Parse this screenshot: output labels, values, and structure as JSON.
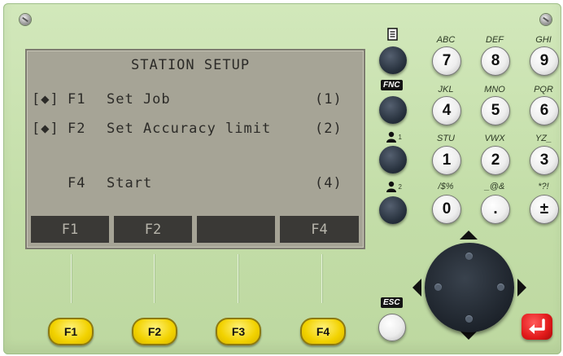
{
  "screen": {
    "title": "STATION SETUP",
    "rows": [
      {
        "marker": "[◆]",
        "key": "F1",
        "label": "Set Job",
        "code": "(1)"
      },
      {
        "marker": "[◆]",
        "key": "F2",
        "label": "Set Accuracy limit",
        "code": "(2)"
      },
      {
        "marker": "",
        "key": "F4",
        "label": "Start",
        "code": "(4)"
      }
    ],
    "softkeys": [
      "F1",
      "F2",
      "",
      "F4"
    ]
  },
  "function_keys": [
    "F1",
    "F2",
    "F3",
    "F4"
  ],
  "side_keys": {
    "fnc_tag": "FNC",
    "esc_tag": "ESC",
    "user1_sub": "1",
    "user2_sub": "2"
  },
  "keypad": [
    {
      "digit": "7",
      "letters": "ABC"
    },
    {
      "digit": "8",
      "letters": "DEF"
    },
    {
      "digit": "9",
      "letters": "GHI"
    },
    {
      "digit": "4",
      "letters": "JKL"
    },
    {
      "digit": "5",
      "letters": "MNO"
    },
    {
      "digit": "6",
      "letters": "PQR"
    },
    {
      "digit": "1",
      "letters": "STU"
    },
    {
      "digit": "2",
      "letters": "VWX"
    },
    {
      "digit": "3",
      "letters": "YZ_"
    },
    {
      "digit": "0",
      "letters": "/$%"
    },
    {
      "digit": ".",
      "letters": "_@&"
    },
    {
      "digit": "±",
      "letters": "*?!"
    }
  ],
  "colors": {
    "panel": "#c8e0ae",
    "lcd": "#a6a496",
    "function_key": "#f2d200",
    "enter_key": "#e21a1a",
    "dark_key": "#26303c"
  }
}
